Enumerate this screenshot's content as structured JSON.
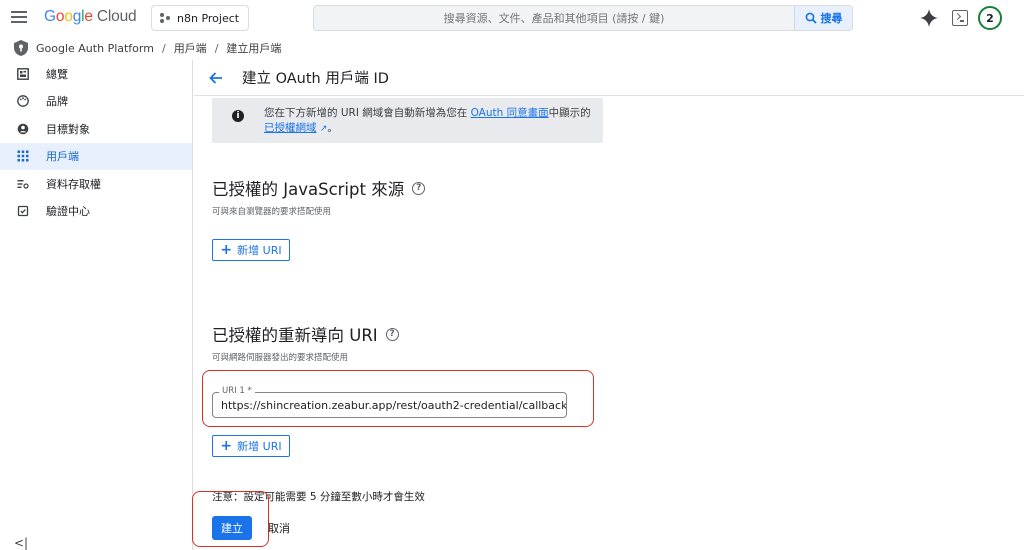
{
  "topbar": {
    "logo_google": "Google",
    "logo_cloud": "Cloud",
    "project_name": "n8n Project",
    "search_placeholder": "搜尋資源、文件、產品和其他項目 (請按 / 鍵)",
    "search_button": "搜尋",
    "notification_count": "2"
  },
  "breadcrumb": {
    "items": [
      "Google Auth Platform",
      "用戶端",
      "建立用戶端"
    ],
    "separator": "/"
  },
  "sidebar": {
    "items": [
      {
        "label": "總覽",
        "icon": "dashboard-icon",
        "active": false
      },
      {
        "label": "品牌",
        "icon": "palette-icon",
        "active": false
      },
      {
        "label": "目標對象",
        "icon": "person-icon",
        "active": false
      },
      {
        "label": "用戶端",
        "icon": "grid-icon",
        "active": true
      },
      {
        "label": "資料存取權",
        "icon": "data-access-icon",
        "active": false
      },
      {
        "label": "驗證中心",
        "icon": "verification-icon",
        "active": false
      }
    ],
    "collapse_glyph": "<|"
  },
  "header": {
    "title": "建立 OAuth 用戶端 ID"
  },
  "info_banner": {
    "text_before": "您在下方新增的 URI 網域會自動新增為您在 ",
    "link1": "OAuth 同意畫面",
    "text_middle": "中顯示的",
    "link2": "已授權網域",
    "text_after": "。"
  },
  "js_origins": {
    "title": "已授權的 JavaScript 來源",
    "subtitle": "可與來自瀏覽器的要求搭配使用",
    "add_button": "新增 URI"
  },
  "redirect_uris": {
    "title": "已授權的重新導向 URI",
    "subtitle": "可與網路伺服器發出的要求搭配使用",
    "field_label": "URI 1 *",
    "field_value": "https://shincreation.zeabur.app/rest/oauth2-credential/callback",
    "add_button": "新增 URI"
  },
  "footer": {
    "note": "注意：設定可能需要 5 分鐘至數小時才會生效",
    "create_button": "建立",
    "cancel_button": "取消"
  },
  "colors": {
    "accent": "#1a73e8",
    "highlight": "#d93025",
    "active_bg": "#e8f0fe"
  }
}
